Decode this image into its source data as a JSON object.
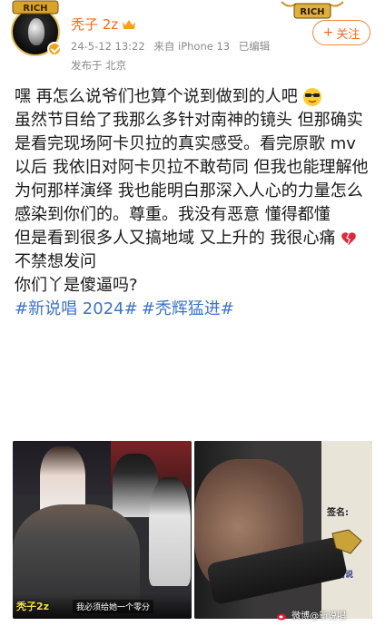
{
  "header": {
    "username": "秃子 2z",
    "timestamp": "24-5-12 13:22",
    "source": "来自 iPhone 13",
    "edited": "已编辑",
    "location": "发布于 北京",
    "follow_label": "关注",
    "badge_text": "RICH"
  },
  "post": {
    "line1": "嘿 再怎么说爷们也算个说到做到的人吧",
    "line2": "虽然节目给了我那么多针对南神的镜头 但那确实是看完现场阿卡贝拉的真实感受。看完原歌 mv 以后 我依旧对阿卡贝拉不敢苟同 但我也能理解他为何那样演绎 我也能明白那深入人心的力量怎么感染到你们的。尊重。我没有恶意 懂得都懂",
    "line3": "但是看到很多人又搞地域 又上升的 我很心痛",
    "line3b": "不禁想发问",
    "line4": "你们丫是傻逼吗?",
    "hashtags": [
      "#新说唱 2024#",
      "#秃辉猛进#"
    ]
  },
  "images": {
    "img1_caption_name": "秃子2z",
    "img1_caption_sub": "我必须给她一个零分",
    "img2_sign": "签名:",
    "img2_henan": "河南说"
  },
  "watermark": "微博@新说唱"
}
